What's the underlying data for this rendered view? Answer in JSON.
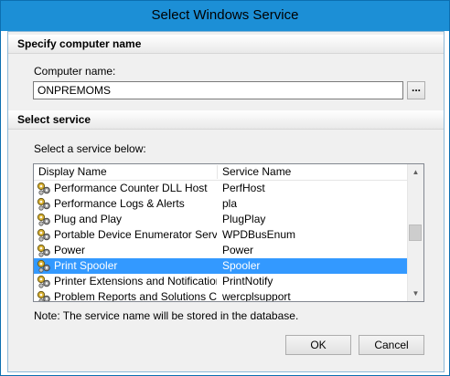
{
  "window": {
    "title": "Select Windows Service"
  },
  "computer_section": {
    "header": "Specify computer name",
    "label": "Computer name:",
    "value": "ONPREMOMS",
    "browse_label": "..."
  },
  "service_section": {
    "header": "Select service",
    "instruction": "Select a service below:",
    "columns": [
      "Display Name",
      "Service Name"
    ],
    "rows": [
      {
        "display": "Performance Counter DLL Host",
        "service": "PerfHost"
      },
      {
        "display": "Performance Logs & Alerts",
        "service": "pla"
      },
      {
        "display": "Plug and Play",
        "service": "PlugPlay"
      },
      {
        "display": "Portable Device Enumerator Service",
        "service": "WPDBusEnum"
      },
      {
        "display": "Power",
        "service": "Power"
      },
      {
        "display": "Print Spooler",
        "service": "Spooler",
        "selected": true
      },
      {
        "display": "Printer Extensions and Notifications",
        "service": "PrintNotify"
      },
      {
        "display": "Problem Reports and Solutions Con...",
        "service": "wercplsupport"
      }
    ],
    "row_icon": "gears-icon",
    "note": "Note: The service name will be stored in the database."
  },
  "buttons": {
    "ok": "OK",
    "cancel": "Cancel"
  },
  "colors": {
    "titlebar": "#1c8fd6",
    "selection": "#3399ff"
  }
}
